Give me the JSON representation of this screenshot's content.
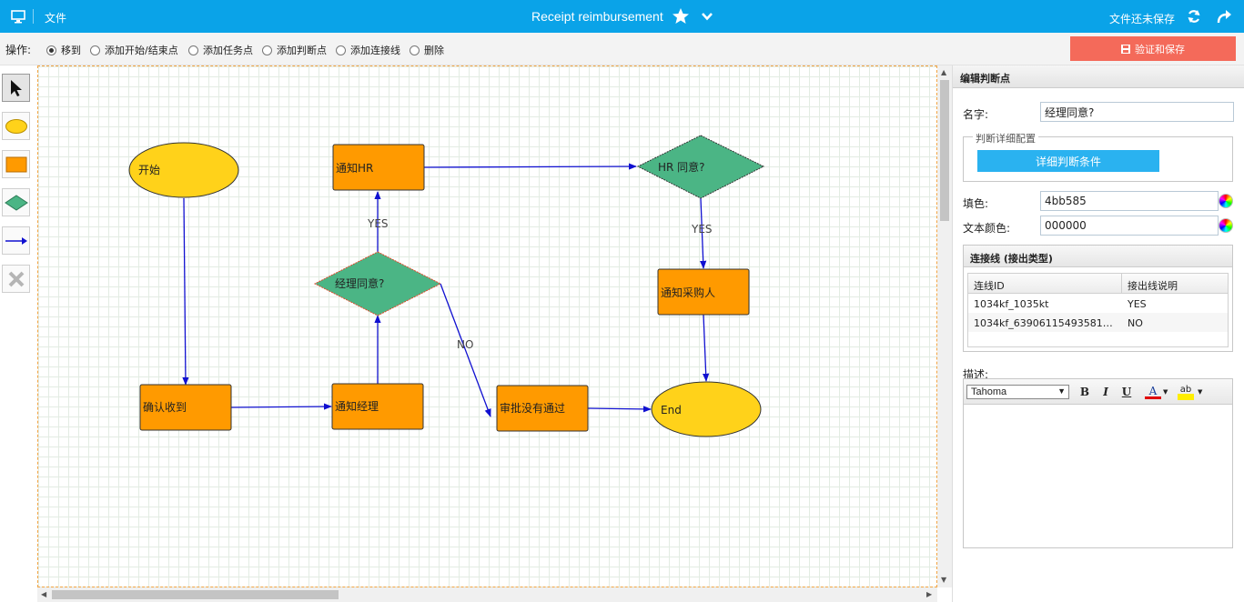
{
  "topbar": {
    "file_menu": "文件",
    "title": "Receipt reimbursement",
    "save_state": "文件还未保存"
  },
  "opbar": {
    "label": "操作:",
    "options": [
      "移到",
      "添加开始/结束点",
      "添加任务点",
      "添加判断点",
      "添加连接线",
      "删除"
    ],
    "selected": "移到",
    "save_button": "验证和保存"
  },
  "flow": {
    "nodes": {
      "start": "开始",
      "confirm": "确认收到",
      "notify_manager": "通知经理",
      "manager_decision": "经理同意?",
      "notify_hr": "通知HR",
      "hr_decision": "HR 同意?",
      "notify_purchase": "通知采购人",
      "rejected": "审批没有通过",
      "end": "End"
    },
    "edge_labels": {
      "manager_yes": "YES",
      "manager_no": "NO",
      "hr_yes": "YES"
    },
    "colors": {
      "ellipse": "#ffd21a",
      "task": "#ff9a00",
      "decision": "#4bb585",
      "edge": "#1010d0"
    }
  },
  "panel": {
    "title": "编辑判断点",
    "name_label": "名字:",
    "name_value": "经理同意?",
    "fieldset_legend": "判断详细配置",
    "detail_button": "详细判断条件",
    "fill_label": "填色:",
    "fill_value": "4bb585",
    "text_color_label": "文本颜色:",
    "text_color_value": "000000",
    "connections": {
      "title": "连接线 (接出类型)",
      "columns": [
        "连线ID",
        "接出线说明"
      ],
      "rows": [
        [
          "1034kf_1035kt",
          "YES"
        ],
        [
          "1034kf_639061154935813324...",
          "NO"
        ]
      ]
    },
    "description_label": "描述:",
    "editor": {
      "font": "Tahoma",
      "bold": "B",
      "italic": "I",
      "underline": "U",
      "font_color": "A",
      "highlight": "ab"
    }
  }
}
